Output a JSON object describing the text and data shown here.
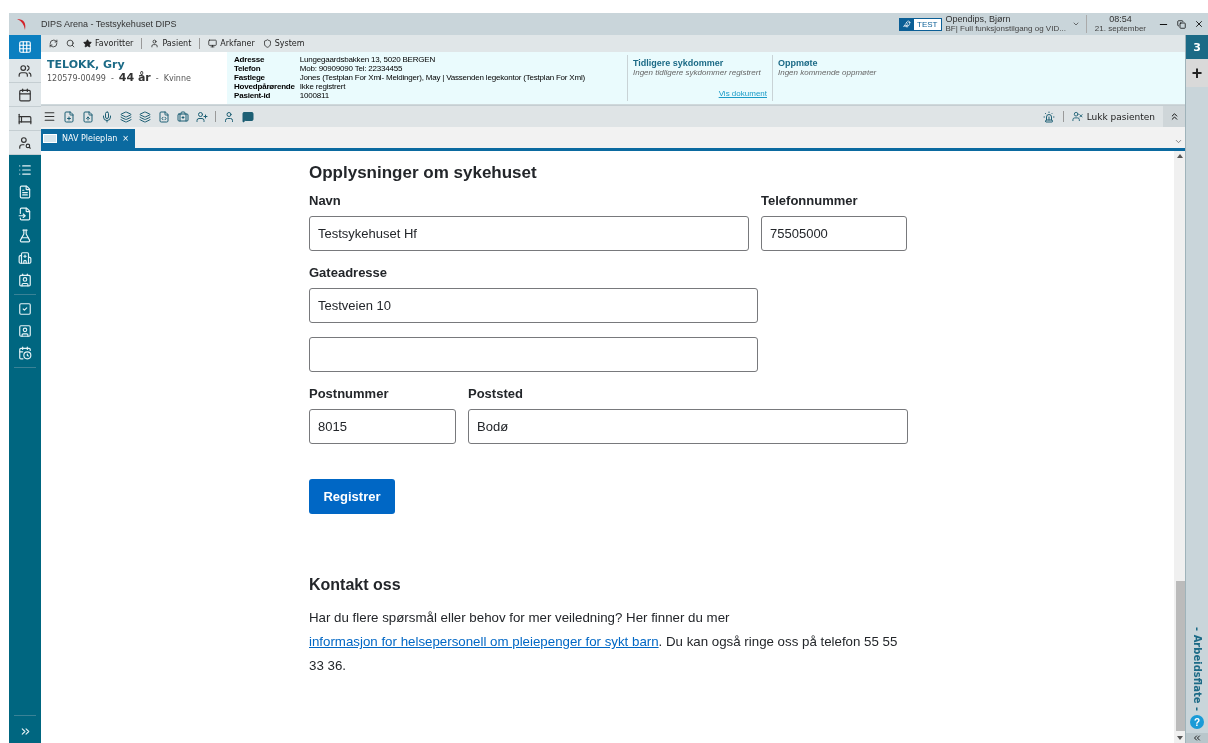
{
  "window": {
    "title": "DIPS Arena - Testsykehuset DIPS",
    "env_badge": "TEST",
    "user_name": "Opendips, Bjørn",
    "user_role": "BF| Full funksjonstilgang og VID...",
    "time": "08:54",
    "date": "21. september"
  },
  "menu": [
    {
      "label": "Favoritter"
    },
    {
      "label": "Pasient"
    },
    {
      "label": "Arkfaner"
    },
    {
      "label": "System"
    }
  ],
  "patient": {
    "name": "TELOKK, Gry",
    "id": "120579-00499",
    "age_separator": "-",
    "age": "44 år",
    "sex_separator": "-",
    "sex": "Kvinne",
    "details": [
      {
        "label": "Adresse",
        "value": "Lungegaardsbakken 13, 5020 BERGEN"
      },
      {
        "label": "Telefon",
        "value": "Mob: 90909090  Tel: 22334455"
      },
      {
        "label": "Fastlege",
        "value": "Jones (Testplan For Xml- Meldinger), May | Vassenden legekontor (Testplan For Xml)"
      },
      {
        "label": "Hovedpårørende",
        "value": "Ikke registrert"
      },
      {
        "label": "Pasient-id",
        "value": "1000811"
      }
    ],
    "panels": [
      {
        "title": "Tidligere sykdommer",
        "note": "Ingen tidligere sykdommer registrert",
        "link": "Vis dokument"
      },
      {
        "title": "Oppmøte",
        "note": "Ingen kommende oppmøter"
      }
    ]
  },
  "toolbar": {
    "close_patient": "Lukk pasienten"
  },
  "tabs": [
    {
      "label": "NAV Pleieplan",
      "close": "×",
      "selected": true
    }
  ],
  "right_rail": {
    "count": "3",
    "plus": "+",
    "label": "- Arbeidsflate -",
    "help": "?"
  },
  "form": {
    "heading": "Opplysninger om sykehuset",
    "rows": [
      [
        {
          "label": "Navn",
          "value": "Testsykehuset Hf"
        },
        {
          "label": "Telefonnummer",
          "value": "75505000"
        }
      ],
      [
        {
          "label": "Gateadresse",
          "value": "Testveien 10"
        }
      ],
      [
        {}
      ],
      [
        {
          "label": "Postnummer",
          "value": "8015"
        },
        {
          "label": "Poststed",
          "value": "Bodø"
        }
      ]
    ],
    "submit": "Registrer"
  },
  "contact": {
    "heading": "Kontakt oss",
    "before": "Har du flere spørsmål eller behov for mer veiledning? Her finner du mer ",
    "link": "informasjon for helsepersonell om pleiepenger for sykt barn",
    "after": ". Du kan også ringe oss på telefon 55 55 33 36."
  }
}
